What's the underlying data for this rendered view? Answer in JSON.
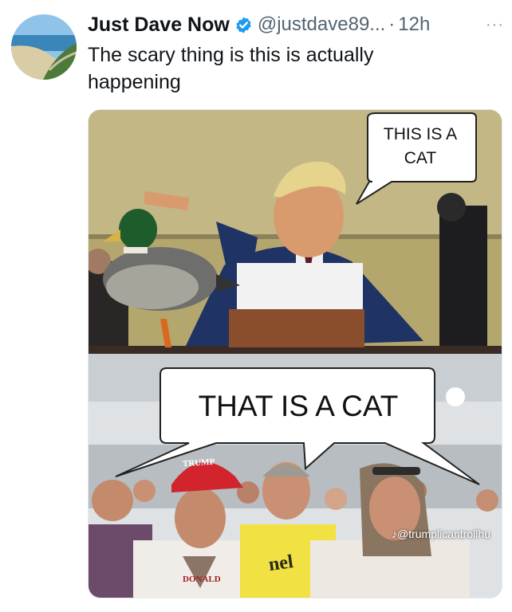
{
  "author": {
    "display_name": "Just Dave Now",
    "handle": "@justdave89...",
    "separator": "·",
    "timestamp": "12h",
    "more_label": "···",
    "verified_color": "#1d9bf0"
  },
  "tweet": {
    "text": "The scary thing is this is actually happening"
  },
  "meme": {
    "top_bubble": "THIS IS A\nCAT",
    "bottom_bubble": "THAT IS A CAT",
    "watermark": "♪@trumplicantrollhu",
    "hat_text": "TRUMP",
    "shirt_text": "DONALD",
    "shirt_text2": "nel"
  },
  "icons": {
    "verified": "verified-badge-icon",
    "more": "more-options-icon"
  }
}
